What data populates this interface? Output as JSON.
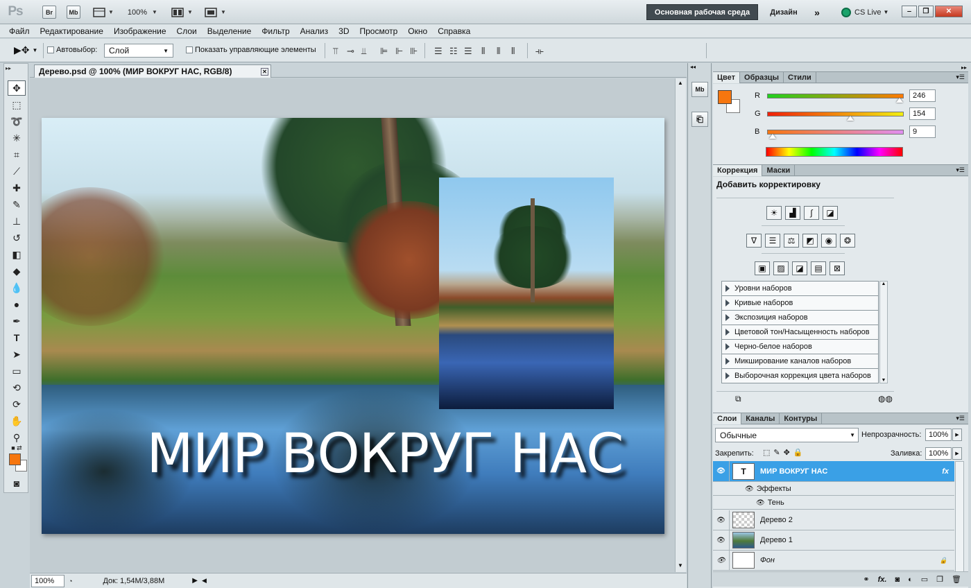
{
  "app": {
    "logo": "Ps",
    "bridge_btn": "Br",
    "minibridge_btn": "Mb",
    "zoom": "100%",
    "workspace_active": "Основная рабочая среда",
    "workspace_design": "Дизайн",
    "more": "»",
    "cslive": "CS Live"
  },
  "menu": [
    "Файл",
    "Редактирование",
    "Изображение",
    "Слои",
    "Выделение",
    "Фильтр",
    "Анализ",
    "3D",
    "Просмотр",
    "Окно",
    "Справка"
  ],
  "options": {
    "autoselect_label": "Автовыбор:",
    "autoselect_value": "Слой",
    "show_controls": "Показать управляющие элементы"
  },
  "document": {
    "tab_title": "Дерево.psd @ 100% (МИР ВОКРУГ НАС, RGB/8)",
    "image_text": "МИР ВОКРУГ НАС"
  },
  "status": {
    "zoom": "100%",
    "doc_info": "Док: 1,54М/3,88М"
  },
  "color_panel": {
    "tabs": [
      "Цвет",
      "Образцы",
      "Стили"
    ],
    "foreground": "#f6760f",
    "background": "#ffffff",
    "channels": [
      {
        "label": "R",
        "value": "246",
        "fraction": 0.965,
        "from": "#1fd11f",
        "to": "#ff7a00"
      },
      {
        "label": "G",
        "value": "154",
        "fraction": 0.604,
        "from": "#f0200a",
        "to": "#f2ee10"
      },
      {
        "label": "B",
        "value": "9",
        "fraction": 0.035,
        "from": "#f67610",
        "to": "#e08ef0"
      }
    ]
  },
  "adjustments_panel": {
    "tabs": [
      "Коррекция",
      "Маски"
    ],
    "heading": "Добавить корректировку",
    "presets": [
      "Уровни наборов",
      "Кривые наборов",
      "Экспозиция наборов",
      "Цветовой тон/Насыщенность наборов",
      "Черно-белое наборов",
      "Микширование каналов наборов",
      "Выборочная коррекция цвета наборов"
    ]
  },
  "layers_panel": {
    "tabs": [
      "Слои",
      "Каналы",
      "Контуры"
    ],
    "blend_mode": "Обычные",
    "opacity_label": "Непрозрачность:",
    "opacity": "100%",
    "lock_label": "Закрепить:",
    "fill_label": "Заливка:",
    "fill": "100%",
    "layers": [
      {
        "name": "МИР ВОКРУГ НАС",
        "thumb": "T",
        "badge": "fx"
      },
      {
        "name": "Эффекты"
      },
      {
        "name": "Тень"
      },
      {
        "name": "Дерево 2"
      },
      {
        "name": "Дерево 1"
      },
      {
        "name": "Фон",
        "badge": "lock"
      }
    ]
  }
}
